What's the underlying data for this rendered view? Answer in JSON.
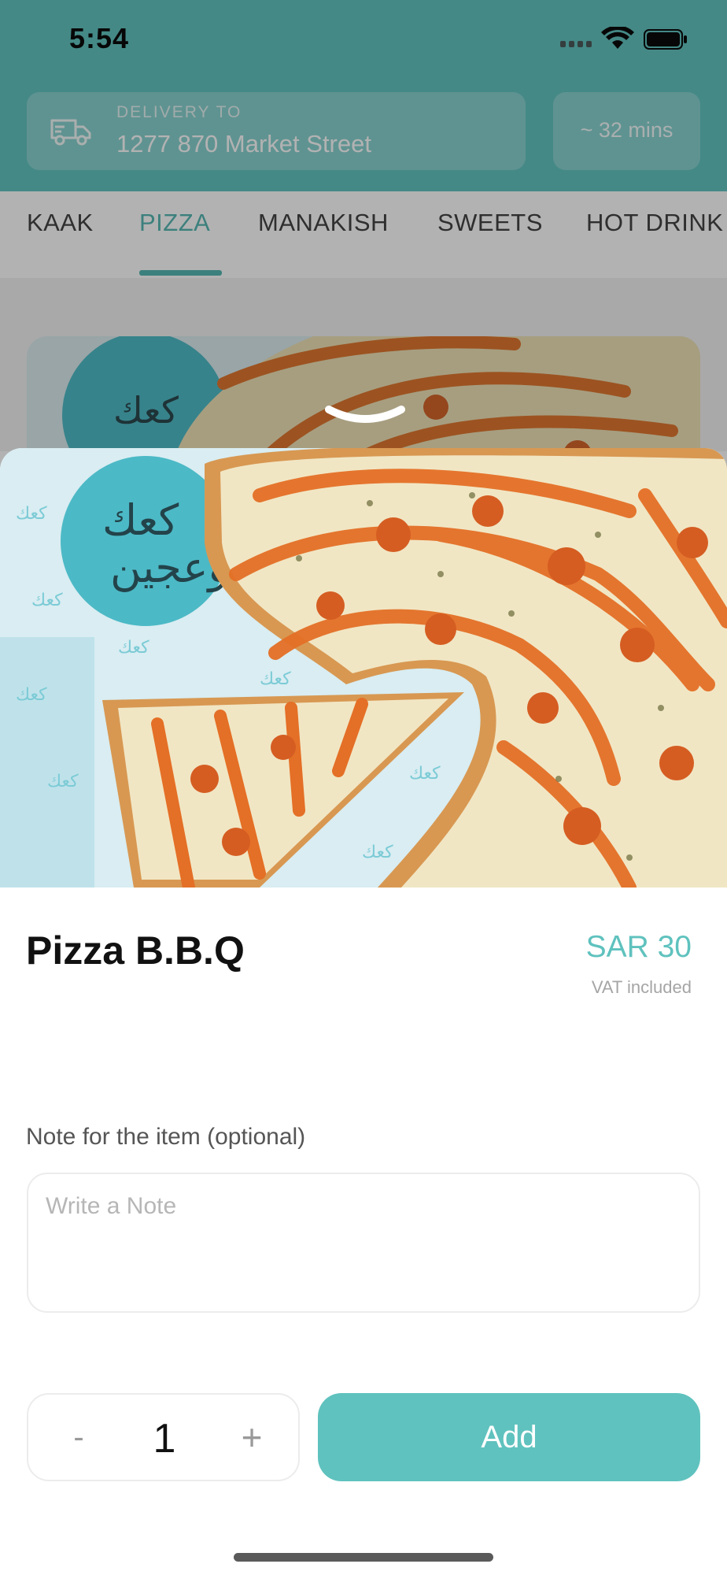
{
  "status_bar": {
    "time": "5:54"
  },
  "header": {
    "delivery_label": "DELIVERY TO",
    "delivery_address": "1277 870 Market Street",
    "eta": "~ 32 mins"
  },
  "tabs": [
    {
      "label": "KAAK",
      "active": false
    },
    {
      "label": "PIZZA",
      "active": true
    },
    {
      "label": "MANAKISH",
      "active": false
    },
    {
      "label": "SWEETS",
      "active": false
    },
    {
      "label": "HOT DRINK",
      "active": false
    }
  ],
  "item": {
    "title": "Pizza B.B.Q",
    "price": "SAR 30",
    "vat_note": "VAT included"
  },
  "note": {
    "label": "Note for the item (optional)",
    "placeholder": "Write a Note",
    "value": ""
  },
  "stepper": {
    "minus": "-",
    "quantity": "1",
    "plus": "+"
  },
  "add_button": {
    "label": "Add"
  },
  "colors": {
    "accent": "#5fc2be",
    "header": "#62c4c0",
    "text": "#111111"
  }
}
